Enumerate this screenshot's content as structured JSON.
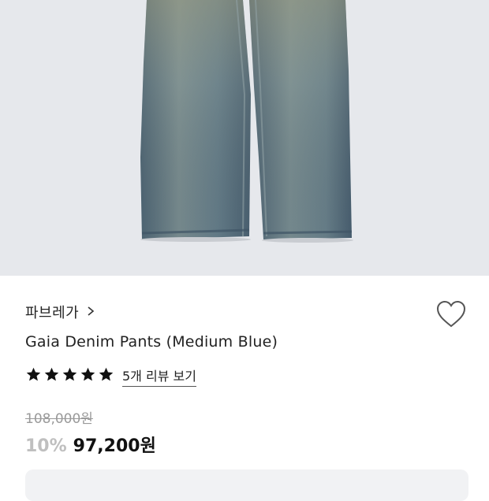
{
  "product": {
    "brand": "파브레가",
    "title": "Gaia Denim Pants (Medium Blue)",
    "rating": 5,
    "reviews_label": "5개 리뷰 보기",
    "original_price": "108,000원",
    "discount": "10%",
    "price": "97,200원"
  },
  "colors": {
    "hero_background": "#e6e8ec",
    "denim": "#5f7889",
    "discount_text": "#bfbfbf"
  },
  "icons": {
    "brand_link": "chevron-right-icon",
    "wishlist": "heart-outline-icon",
    "rating": "star-icon"
  }
}
